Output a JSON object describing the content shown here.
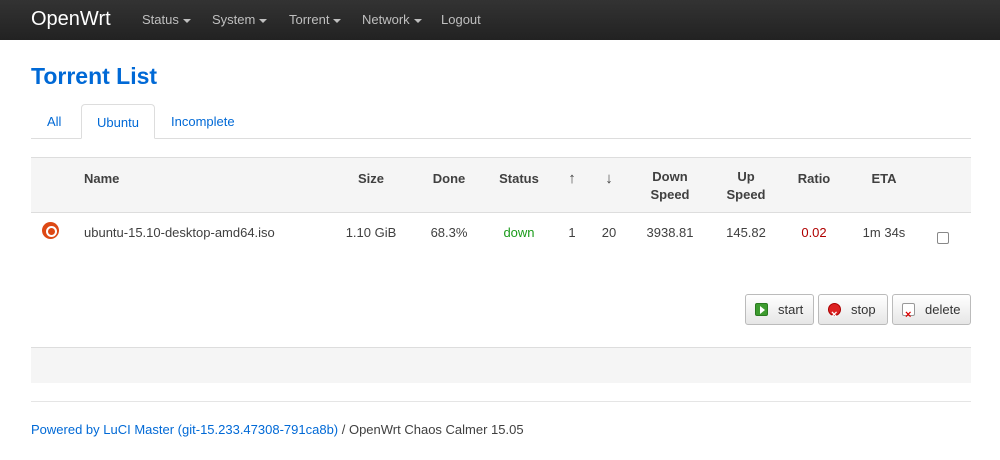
{
  "navbar": {
    "brand": "OpenWrt",
    "items": [
      {
        "label": "Status"
      },
      {
        "label": "System"
      },
      {
        "label": "Torrent"
      },
      {
        "label": "Network"
      },
      {
        "label": "Logout"
      }
    ]
  },
  "page": {
    "title": "Torrent List"
  },
  "tabs": [
    {
      "label": "All"
    },
    {
      "label": "Ubuntu",
      "active": true
    },
    {
      "label": "Incomplete"
    }
  ],
  "table": {
    "headers": {
      "name": "Name",
      "size": "Size",
      "done": "Done",
      "status": "Status",
      "up_arrow": "↑",
      "down_arrow": "↓",
      "down_speed_1": "Down",
      "down_speed_2": "Speed",
      "up_speed_1": "Up",
      "up_speed_2": "Speed",
      "ratio": "Ratio",
      "eta": "ETA"
    },
    "rows": [
      {
        "icon": "ubuntu-icon",
        "name": "ubuntu-15.10-desktop-amd64.iso",
        "size": "1.10 GiB",
        "done": "68.3%",
        "status": "down",
        "seeds_up": "1",
        "peers_down": "20",
        "down_speed": "3938.81",
        "up_speed": "145.82",
        "ratio": "0.02",
        "eta": "1m 34s"
      }
    ]
  },
  "actions": {
    "start": "start",
    "stop": "stop",
    "delete": "delete"
  },
  "footer": {
    "powered_link": "Powered by LuCI Master (git-15.233.47308-791ca8b)",
    "suffix": " / OpenWrt Chaos Calmer 15.05"
  },
  "colors": {
    "accent": "#0069d6",
    "status_down": "#1a9b1a",
    "ratio": "#b00000"
  }
}
